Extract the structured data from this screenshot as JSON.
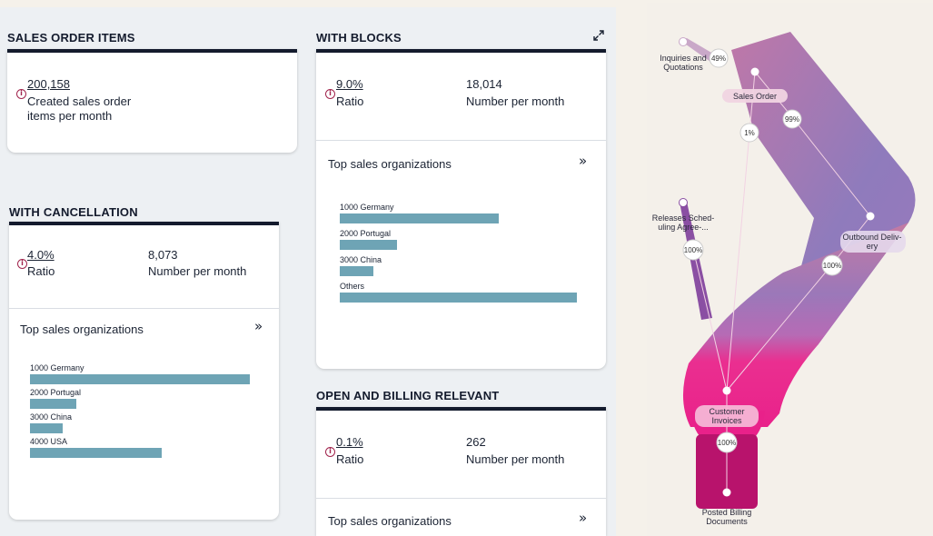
{
  "sales_order_items": {
    "title": "SALES ORDER ITEMS",
    "value": "200,158",
    "label_line1": "Created sales order",
    "label_line2": "items per month"
  },
  "with_blocks": {
    "title": "WITH BLOCKS",
    "ratio_value": "9.0%",
    "ratio_label": "Ratio",
    "count_value": "18,014",
    "count_label": "Number per month",
    "top_title": "Top sales organizations",
    "bars": [
      {
        "label": "1000 Germany",
        "fraction": 0.67
      },
      {
        "label": "2000 Portugal",
        "fraction": 0.24
      },
      {
        "label": "3000 China",
        "fraction": 0.14
      },
      {
        "label": "Others",
        "fraction": 1.0
      }
    ]
  },
  "with_cancellation": {
    "title": "WITH CANCELLATION",
    "ratio_value": "4.0%",
    "ratio_label": "Ratio",
    "count_value": "8,073",
    "count_label": "Number per month",
    "top_title": "Top sales organizations",
    "bars": [
      {
        "label": "1000 Germany",
        "fraction": 1.0
      },
      {
        "label": "2000 Portugal",
        "fraction": 0.21
      },
      {
        "label": "3000 China",
        "fraction": 0.15
      },
      {
        "label": "4000 USA",
        "fraction": 0.6
      }
    ]
  },
  "open_billing": {
    "title": "OPEN AND BILLING RELEVANT",
    "ratio_value": "0.1%",
    "ratio_label": "Ratio",
    "count_value": "262",
    "count_label": "Number per month",
    "top_title": "Top sales organizations"
  },
  "sankey": {
    "nodes": {
      "inquiries_l1": "Inquiries and",
      "inquiries_l2": "Quotations",
      "sales_order": "Sales Order",
      "releases_l1": "Releases Sched-",
      "releases_l2": "uling Agree-...",
      "outbound_l1": "Outbound Deliv-",
      "outbound_l2": "ery",
      "customer_l1": "Customer",
      "customer_l2": "Invoices",
      "posted_l1": "Posted Billing",
      "posted_l2": "Documents"
    },
    "percents": {
      "p49": "49%",
      "p99": "99%",
      "p1": "1%",
      "p100a": "100%",
      "p100b": "100%",
      "p100c": "100%"
    }
  }
}
